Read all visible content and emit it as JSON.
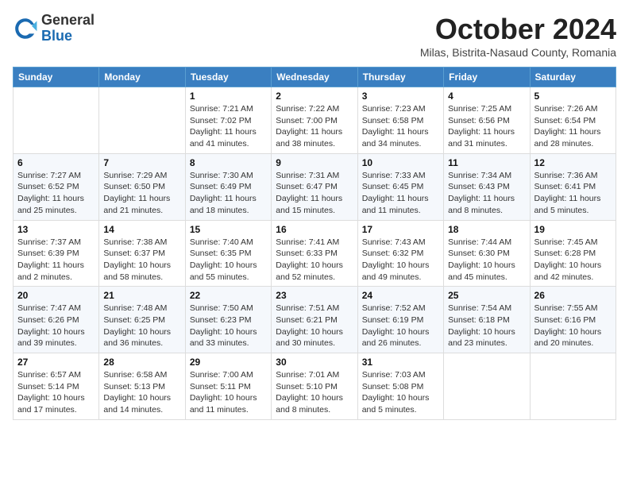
{
  "header": {
    "logo_general": "General",
    "logo_blue": "Blue",
    "month_title": "October 2024",
    "location": "Milas, Bistrita-Nasaud County, Romania"
  },
  "days_of_week": [
    "Sunday",
    "Monday",
    "Tuesday",
    "Wednesday",
    "Thursday",
    "Friday",
    "Saturday"
  ],
  "weeks": [
    [
      {
        "day": "",
        "info": ""
      },
      {
        "day": "",
        "info": ""
      },
      {
        "day": "1",
        "info": "Sunrise: 7:21 AM\nSunset: 7:02 PM\nDaylight: 11 hours and 41 minutes."
      },
      {
        "day": "2",
        "info": "Sunrise: 7:22 AM\nSunset: 7:00 PM\nDaylight: 11 hours and 38 minutes."
      },
      {
        "day": "3",
        "info": "Sunrise: 7:23 AM\nSunset: 6:58 PM\nDaylight: 11 hours and 34 minutes."
      },
      {
        "day": "4",
        "info": "Sunrise: 7:25 AM\nSunset: 6:56 PM\nDaylight: 11 hours and 31 minutes."
      },
      {
        "day": "5",
        "info": "Sunrise: 7:26 AM\nSunset: 6:54 PM\nDaylight: 11 hours and 28 minutes."
      }
    ],
    [
      {
        "day": "6",
        "info": "Sunrise: 7:27 AM\nSunset: 6:52 PM\nDaylight: 11 hours and 25 minutes."
      },
      {
        "day": "7",
        "info": "Sunrise: 7:29 AM\nSunset: 6:50 PM\nDaylight: 11 hours and 21 minutes."
      },
      {
        "day": "8",
        "info": "Sunrise: 7:30 AM\nSunset: 6:49 PM\nDaylight: 11 hours and 18 minutes."
      },
      {
        "day": "9",
        "info": "Sunrise: 7:31 AM\nSunset: 6:47 PM\nDaylight: 11 hours and 15 minutes."
      },
      {
        "day": "10",
        "info": "Sunrise: 7:33 AM\nSunset: 6:45 PM\nDaylight: 11 hours and 11 minutes."
      },
      {
        "day": "11",
        "info": "Sunrise: 7:34 AM\nSunset: 6:43 PM\nDaylight: 11 hours and 8 minutes."
      },
      {
        "day": "12",
        "info": "Sunrise: 7:36 AM\nSunset: 6:41 PM\nDaylight: 11 hours and 5 minutes."
      }
    ],
    [
      {
        "day": "13",
        "info": "Sunrise: 7:37 AM\nSunset: 6:39 PM\nDaylight: 11 hours and 2 minutes."
      },
      {
        "day": "14",
        "info": "Sunrise: 7:38 AM\nSunset: 6:37 PM\nDaylight: 10 hours and 58 minutes."
      },
      {
        "day": "15",
        "info": "Sunrise: 7:40 AM\nSunset: 6:35 PM\nDaylight: 10 hours and 55 minutes."
      },
      {
        "day": "16",
        "info": "Sunrise: 7:41 AM\nSunset: 6:33 PM\nDaylight: 10 hours and 52 minutes."
      },
      {
        "day": "17",
        "info": "Sunrise: 7:43 AM\nSunset: 6:32 PM\nDaylight: 10 hours and 49 minutes."
      },
      {
        "day": "18",
        "info": "Sunrise: 7:44 AM\nSunset: 6:30 PM\nDaylight: 10 hours and 45 minutes."
      },
      {
        "day": "19",
        "info": "Sunrise: 7:45 AM\nSunset: 6:28 PM\nDaylight: 10 hours and 42 minutes."
      }
    ],
    [
      {
        "day": "20",
        "info": "Sunrise: 7:47 AM\nSunset: 6:26 PM\nDaylight: 10 hours and 39 minutes."
      },
      {
        "day": "21",
        "info": "Sunrise: 7:48 AM\nSunset: 6:25 PM\nDaylight: 10 hours and 36 minutes."
      },
      {
        "day": "22",
        "info": "Sunrise: 7:50 AM\nSunset: 6:23 PM\nDaylight: 10 hours and 33 minutes."
      },
      {
        "day": "23",
        "info": "Sunrise: 7:51 AM\nSunset: 6:21 PM\nDaylight: 10 hours and 30 minutes."
      },
      {
        "day": "24",
        "info": "Sunrise: 7:52 AM\nSunset: 6:19 PM\nDaylight: 10 hours and 26 minutes."
      },
      {
        "day": "25",
        "info": "Sunrise: 7:54 AM\nSunset: 6:18 PM\nDaylight: 10 hours and 23 minutes."
      },
      {
        "day": "26",
        "info": "Sunrise: 7:55 AM\nSunset: 6:16 PM\nDaylight: 10 hours and 20 minutes."
      }
    ],
    [
      {
        "day": "27",
        "info": "Sunrise: 6:57 AM\nSunset: 5:14 PM\nDaylight: 10 hours and 17 minutes."
      },
      {
        "day": "28",
        "info": "Sunrise: 6:58 AM\nSunset: 5:13 PM\nDaylight: 10 hours and 14 minutes."
      },
      {
        "day": "29",
        "info": "Sunrise: 7:00 AM\nSunset: 5:11 PM\nDaylight: 10 hours and 11 minutes."
      },
      {
        "day": "30",
        "info": "Sunrise: 7:01 AM\nSunset: 5:10 PM\nDaylight: 10 hours and 8 minutes."
      },
      {
        "day": "31",
        "info": "Sunrise: 7:03 AM\nSunset: 5:08 PM\nDaylight: 10 hours and 5 minutes."
      },
      {
        "day": "",
        "info": ""
      },
      {
        "day": "",
        "info": ""
      }
    ]
  ]
}
